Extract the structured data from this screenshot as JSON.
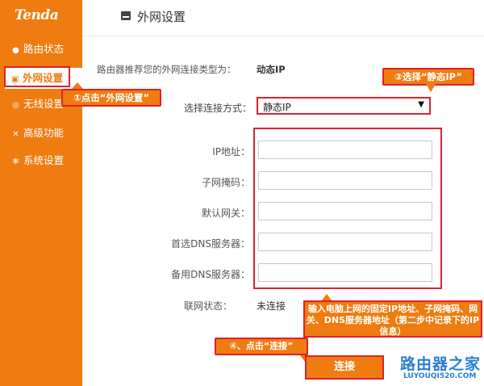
{
  "brand": "Tenda",
  "sidebar": {
    "items": [
      {
        "icon": "dashboard-icon",
        "glyph": "●",
        "label": "路由状态"
      },
      {
        "icon": "wan-icon",
        "glyph": "▣",
        "label": "外网设置",
        "active": true
      },
      {
        "icon": "wifi-icon",
        "glyph": "◎",
        "label": "无线设置"
      },
      {
        "icon": "tools-icon",
        "glyph": "✕",
        "label": "高级功能"
      },
      {
        "icon": "settings-icon",
        "glyph": "✻",
        "label": "系统设置"
      }
    ]
  },
  "header": {
    "title": "外网设置",
    "icon": "wan-icon"
  },
  "main": {
    "recommend_label": "路由器推荐您的外网连接类型为：",
    "recommend_value": "动态IP",
    "mode_label": "选择连接方式：",
    "mode_value": "静态IP",
    "fields": [
      {
        "label": "IP地址：",
        "value": ""
      },
      {
        "label": "子网掩码：",
        "value": ""
      },
      {
        "label": "默认网关：",
        "value": ""
      },
      {
        "label": "首选DNS服务器：",
        "value": ""
      },
      {
        "label": "备用DNS服务器：",
        "value": ""
      }
    ],
    "status_label": "联网状态：",
    "status_value": "未连接",
    "connect_label": "连接"
  },
  "annotations": {
    "step1": "①点击“外网设置”",
    "step2": "②选择“静态IP”",
    "step3": "输入电脑上网的固定IP地址、子网掩码、网关、DNS服务器地址（第二步中记录下的IP信息）",
    "step4": "④、点击“连接”"
  },
  "watermark": {
    "text": "路由器之家",
    "url": "LUYOUQI520.COM"
  },
  "colors": {
    "accent": "#ee7c11",
    "highlight": "#e0202a",
    "watermark": "#2a7fd0"
  }
}
